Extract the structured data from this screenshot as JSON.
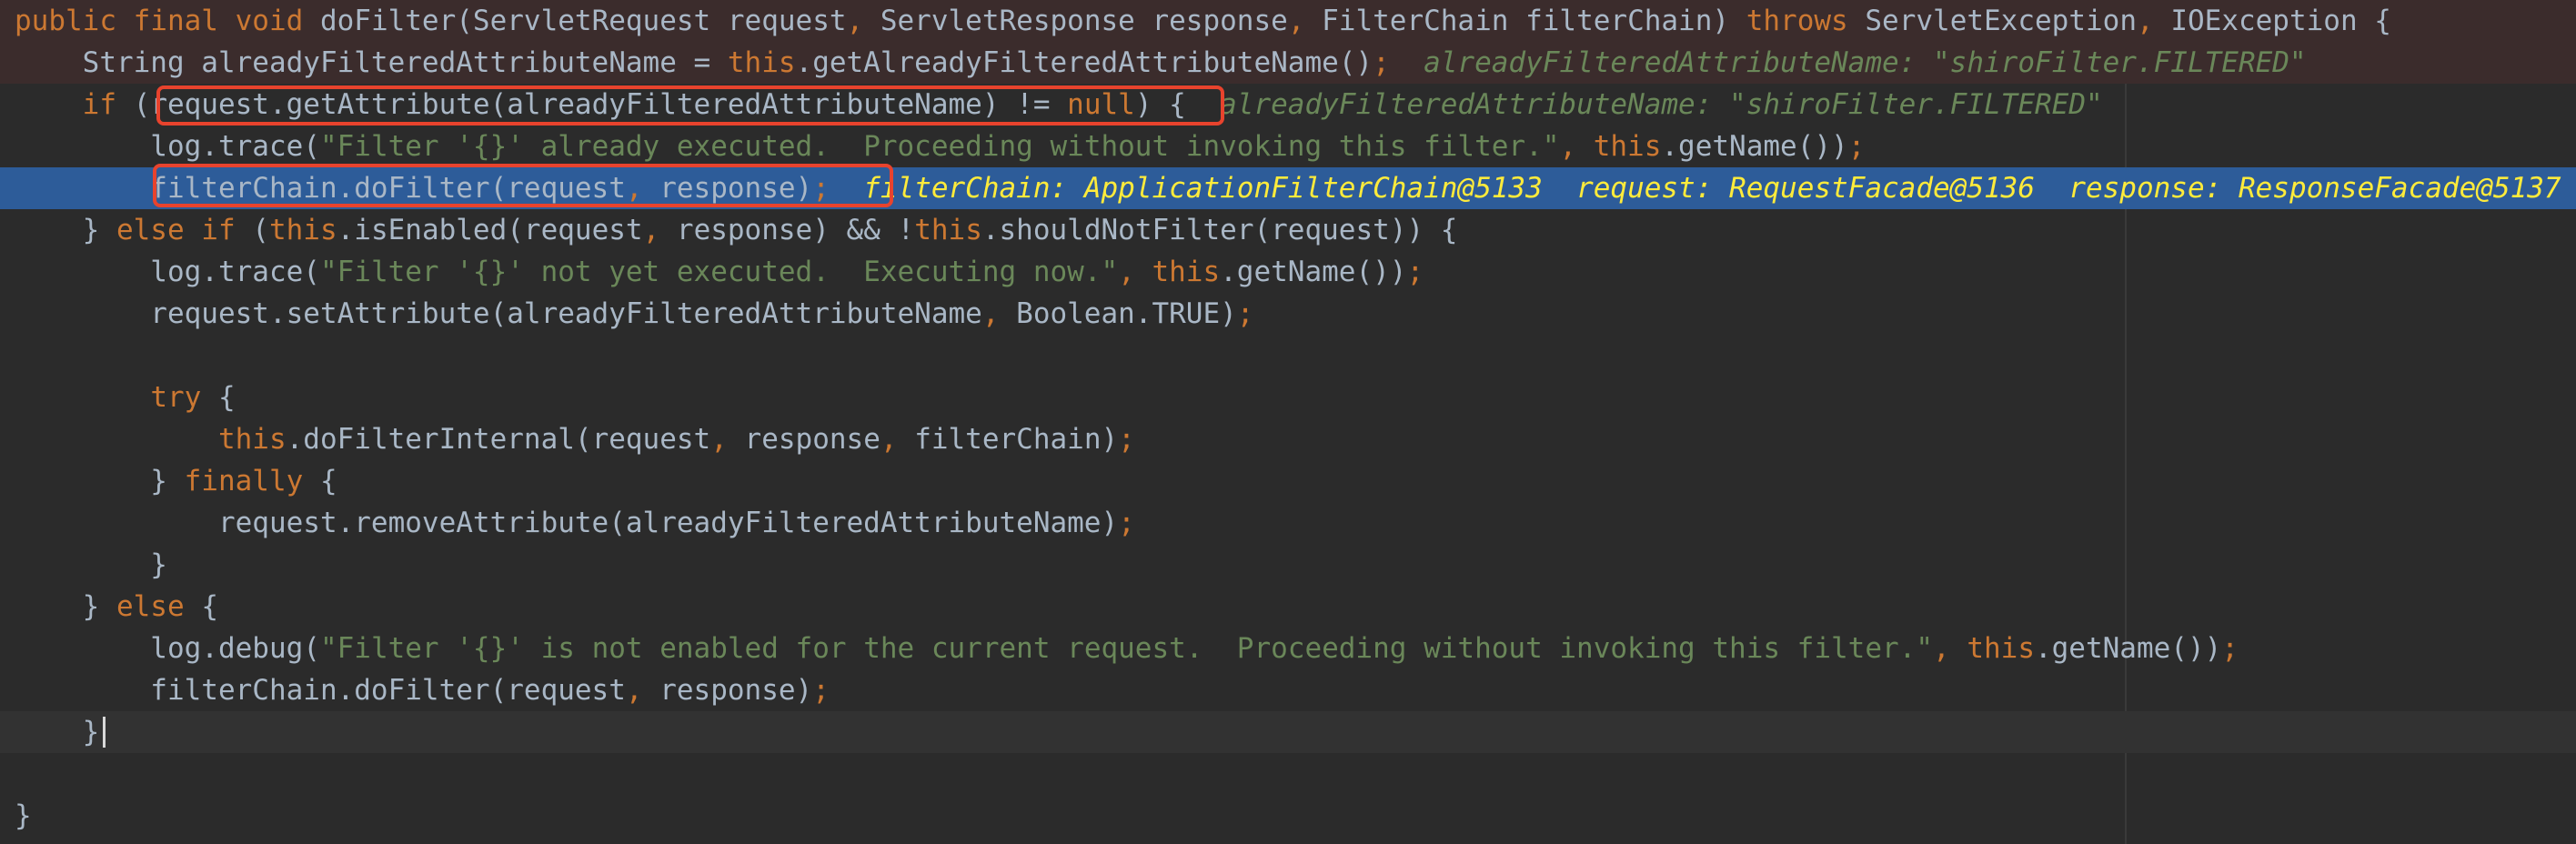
{
  "editor": {
    "lines": [
      {
        "id": "l1",
        "segments": [
          {
            "t": "public final void ",
            "c": "kw"
          },
          {
            "t": "doFilter(ServletRequest request",
            "c": "pl"
          },
          {
            "t": ", ",
            "c": "pun"
          },
          {
            "t": "ServletResponse response",
            "c": "pl"
          },
          {
            "t": ", ",
            "c": "pun"
          },
          {
            "t": "FilterChain filterChain) ",
            "c": "pl"
          },
          {
            "t": "throws ",
            "c": "kw"
          },
          {
            "t": "ServletException",
            "c": "pl"
          },
          {
            "t": ", ",
            "c": "pun"
          },
          {
            "t": "IOException {",
            "c": "pl"
          }
        ]
      },
      {
        "id": "l2",
        "segments": [
          {
            "t": "    String alreadyFilteredAttributeName = ",
            "c": "pl"
          },
          {
            "t": "this",
            "c": "kw"
          },
          {
            "t": ".getAlreadyFilteredAttributeName()",
            "c": "pl"
          },
          {
            "t": ";",
            "c": "pun"
          },
          {
            "t": "  alreadyFilteredAttributeName: \"shiroFilter.FILTERED\"",
            "c": "inl"
          }
        ]
      },
      {
        "id": "l3",
        "segments": [
          {
            "t": "    ",
            "c": "pl"
          },
          {
            "t": "if ",
            "c": "kw"
          },
          {
            "t": "(request.getAttribute(alreadyFilteredAttributeName) != ",
            "c": "pl"
          },
          {
            "t": "null",
            "c": "kw"
          },
          {
            "t": ") {",
            "c": "pl"
          },
          {
            "t": "  alreadyFilteredAttributeName: \"shiroFilter.FILTERED\"",
            "c": "inl"
          }
        ]
      },
      {
        "id": "l4",
        "segments": [
          {
            "t": "        log.trace(",
            "c": "pl"
          },
          {
            "t": "\"Filter '{}' already executed.  Proceeding without invoking this filter.\"",
            "c": "str"
          },
          {
            "t": ", ",
            "c": "pun"
          },
          {
            "t": "this",
            "c": "kw"
          },
          {
            "t": ".getName())",
            "c": "pl"
          },
          {
            "t": ";",
            "c": "pun"
          }
        ]
      },
      {
        "id": "l5",
        "segments": [
          {
            "t": "        filterChain.doFilter(request",
            "c": "pl"
          },
          {
            "t": ", ",
            "c": "pun"
          },
          {
            "t": "response)",
            "c": "pl"
          },
          {
            "t": ";",
            "c": "pun"
          },
          {
            "t": "  filterChain: ApplicationFilterChain@5133  request: RequestFacade@5136  response: ResponseFacade@5137",
            "c": "dbg"
          }
        ]
      },
      {
        "id": "l6",
        "segments": [
          {
            "t": "    } ",
            "c": "pl"
          },
          {
            "t": "else if ",
            "c": "kw"
          },
          {
            "t": "(",
            "c": "pl"
          },
          {
            "t": "this",
            "c": "kw"
          },
          {
            "t": ".isEnabled(request",
            "c": "pl"
          },
          {
            "t": ", ",
            "c": "pun"
          },
          {
            "t": "response) && !",
            "c": "pl"
          },
          {
            "t": "this",
            "c": "kw"
          },
          {
            "t": ".shouldNotFilter(request)) {",
            "c": "pl"
          }
        ]
      },
      {
        "id": "l7",
        "segments": [
          {
            "t": "        log.trace(",
            "c": "pl"
          },
          {
            "t": "\"Filter '{}' not yet executed.  Executing now.\"",
            "c": "str"
          },
          {
            "t": ", ",
            "c": "pun"
          },
          {
            "t": "this",
            "c": "kw"
          },
          {
            "t": ".getName())",
            "c": "pl"
          },
          {
            "t": ";",
            "c": "pun"
          }
        ]
      },
      {
        "id": "l8",
        "segments": [
          {
            "t": "        request.setAttribute(alreadyFilteredAttributeName",
            "c": "pl"
          },
          {
            "t": ", ",
            "c": "pun"
          },
          {
            "t": "Boolean.TRUE)",
            "c": "pl"
          },
          {
            "t": ";",
            "c": "pun"
          }
        ]
      },
      {
        "id": "l9",
        "segments": []
      },
      {
        "id": "l10",
        "segments": [
          {
            "t": "        ",
            "c": "pl"
          },
          {
            "t": "try ",
            "c": "kw"
          },
          {
            "t": "{",
            "c": "pl"
          }
        ]
      },
      {
        "id": "l11",
        "segments": [
          {
            "t": "            ",
            "c": "pl"
          },
          {
            "t": "this",
            "c": "kw"
          },
          {
            "t": ".doFilterInternal(request",
            "c": "pl"
          },
          {
            "t": ", ",
            "c": "pun"
          },
          {
            "t": "response",
            "c": "pl"
          },
          {
            "t": ", ",
            "c": "pun"
          },
          {
            "t": "filterChain)",
            "c": "pl"
          },
          {
            "t": ";",
            "c": "pun"
          }
        ]
      },
      {
        "id": "l12",
        "segments": [
          {
            "t": "        } ",
            "c": "pl"
          },
          {
            "t": "finally ",
            "c": "kw"
          },
          {
            "t": "{",
            "c": "pl"
          }
        ]
      },
      {
        "id": "l13",
        "segments": [
          {
            "t": "            request.removeAttribute(alreadyFilteredAttributeName)",
            "c": "pl"
          },
          {
            "t": ";",
            "c": "pun"
          }
        ]
      },
      {
        "id": "l14",
        "segments": [
          {
            "t": "        }",
            "c": "pl"
          }
        ]
      },
      {
        "id": "l15",
        "segments": [
          {
            "t": "    } ",
            "c": "pl"
          },
          {
            "t": "else ",
            "c": "kw"
          },
          {
            "t": "{",
            "c": "pl"
          }
        ]
      },
      {
        "id": "l16",
        "segments": [
          {
            "t": "        log.debug(",
            "c": "pl"
          },
          {
            "t": "\"Filter '{}' is not enabled for the current request.  Proceeding without invoking this filter.\"",
            "c": "str"
          },
          {
            "t": ", ",
            "c": "pun"
          },
          {
            "t": "this",
            "c": "kw"
          },
          {
            "t": ".getName())",
            "c": "pl"
          },
          {
            "t": ";",
            "c": "pun"
          }
        ]
      },
      {
        "id": "l17",
        "segments": [
          {
            "t": "        filterChain.doFilter(request",
            "c": "pl"
          },
          {
            "t": ", ",
            "c": "pun"
          },
          {
            "t": "response)",
            "c": "pl"
          },
          {
            "t": ";",
            "c": "pun"
          }
        ]
      },
      {
        "id": "l18",
        "segments": [
          {
            "t": "    }",
            "c": "pl"
          }
        ]
      },
      {
        "id": "l19",
        "segments": []
      },
      {
        "id": "l20",
        "segments": [
          {
            "t": "}",
            "c": "pl"
          }
        ]
      }
    ]
  },
  "colors": {
    "background": "#2b2b2b",
    "keyword": "#cc7832",
    "string": "#6a8759",
    "plain": "#a9b7c6",
    "debug_value": "#ffeb3b",
    "execution_line": "#2d5c99",
    "breakpoint_line": "#3b2c2c",
    "highlight_box": "#e8432d"
  }
}
